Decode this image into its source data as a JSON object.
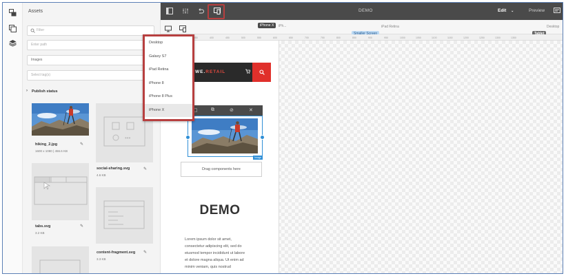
{
  "assets_panel": {
    "title": "Assets",
    "filter_placeholder": "Filter",
    "path_placeholder": "Enter path",
    "type_value": "Images",
    "tags_placeholder": "Select tag(s)",
    "publish_status": "Publish status",
    "cards": [
      {
        "name": "hiking_2.jpg",
        "meta": "1600 x 1080 | 456.6 KB"
      },
      {
        "name": "social-sharing.svg",
        "meta": "4.6 KB"
      },
      {
        "name": "tabs.svg",
        "meta": "3.2 KB"
      },
      {
        "name": "content-fragment.svg",
        "meta": "3.3 KB"
      }
    ]
  },
  "toolbar": {
    "title": "DEMO",
    "mode": "Edit",
    "preview": "Preview"
  },
  "emulator": {
    "current_device": "iPhone X",
    "truncated_label": "iPh...",
    "ipad_retina": "iPad Retina",
    "smaller_screen": "Smaller Screen",
    "desktop": "Desktop",
    "tablet": "Tablet",
    "ruler_ticks": [
      "350",
      "400",
      "450",
      "500",
      "550",
      "600",
      "650",
      "700",
      "750",
      "800",
      "850",
      "900",
      "950",
      "1000",
      "1050",
      "1100",
      "1150",
      "1200",
      "1250",
      "1300",
      "1350"
    ]
  },
  "device_menu": {
    "items": [
      "Desktop",
      "Galaxy S7",
      "iPad Retina",
      "iPhone 8",
      "iPhone 8 Plus",
      "iPhone X"
    ],
    "selected": "iPhone X"
  },
  "page": {
    "logo_prefix": "WE.",
    "logo_suffix": "RETAIL",
    "image_tag": "Image",
    "drag_text": "Drag components here",
    "heading": "DEMO",
    "paragraph_lines": [
      "Lorem ipsum dolor sit amet,",
      "consectetur adipiscing elit, sed do",
      "eiusmod tempor incididunt ut labore",
      "et dolore magna aliqua. Ut enim ad",
      "minim veniam, quis nostrud"
    ]
  },
  "colors": {
    "toolbar_bg": "#4a4a4a",
    "highlight": "#b73f3f",
    "selection_blue": "#2f8fd6",
    "accent_red": "#e0302b"
  }
}
